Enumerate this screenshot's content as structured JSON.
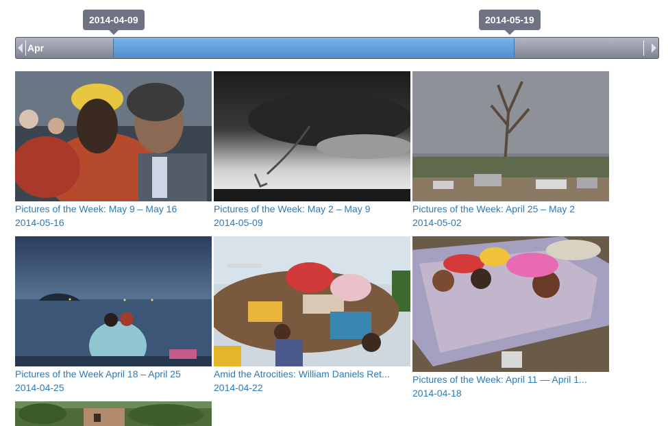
{
  "timeline": {
    "start_label": "2014-04-09",
    "end_label": "2014-05-19",
    "month_label": "Apr"
  },
  "cards": [
    {
      "title": "Pictures of the Week: May 9 – May 16",
      "date": "2014-05-16",
      "image": "miner-rescue-photo"
    },
    {
      "title": "Pictures of the Week: May 2 – May 9",
      "date": "2014-05-09",
      "image": "tornado-photo"
    },
    {
      "title": "Pictures of the Week: April 25 – May 2",
      "date": "2014-05-02",
      "image": "storm-damage-tree-photo"
    },
    {
      "title": "Pictures of the Week April 18 – April 25",
      "date": "2014-04-25",
      "image": "sea-vigil-photo"
    },
    {
      "title": "Amid the Atrocities: William Daniels Ret...",
      "date": "2014-04-22",
      "image": "refugee-truck-photo"
    },
    {
      "title": "Pictures of the Week: April 11 — April 1...",
      "date": "2014-04-18",
      "image": "sleeping-children-photo"
    },
    {
      "title": "",
      "date": "",
      "image": "garden-building-photo"
    }
  ]
}
